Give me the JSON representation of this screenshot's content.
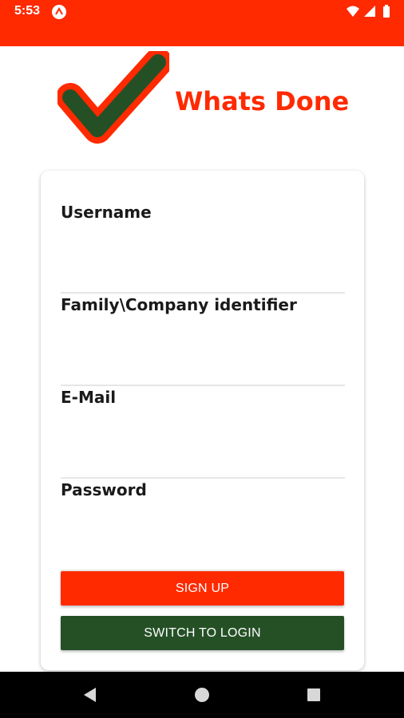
{
  "status_bar": {
    "time": "5:53",
    "background": "#ff2a00",
    "icons": [
      "app-notification-icon",
      "wifi-icon",
      "signal-icon",
      "battery-icon"
    ]
  },
  "header": {
    "title": "Whats Done",
    "title_color": "#ff2a00",
    "logo_icon": "checkmark-logo",
    "logo_fill": "#255026",
    "logo_outline": "#ff2a00"
  },
  "form": {
    "fields": [
      {
        "label": "Username",
        "value": ""
      },
      {
        "label": "Family\\Company identifier",
        "value": ""
      },
      {
        "label": "E-Mail",
        "value": ""
      },
      {
        "label": "Password",
        "value": ""
      }
    ],
    "signup_label": "SIGN UP",
    "switch_label": "SWITCH TO LOGIN",
    "signup_color": "#ff2a00",
    "switch_color": "#255026"
  },
  "nav_bar": {
    "icons": [
      "back-icon",
      "home-icon",
      "recents-icon"
    ]
  }
}
